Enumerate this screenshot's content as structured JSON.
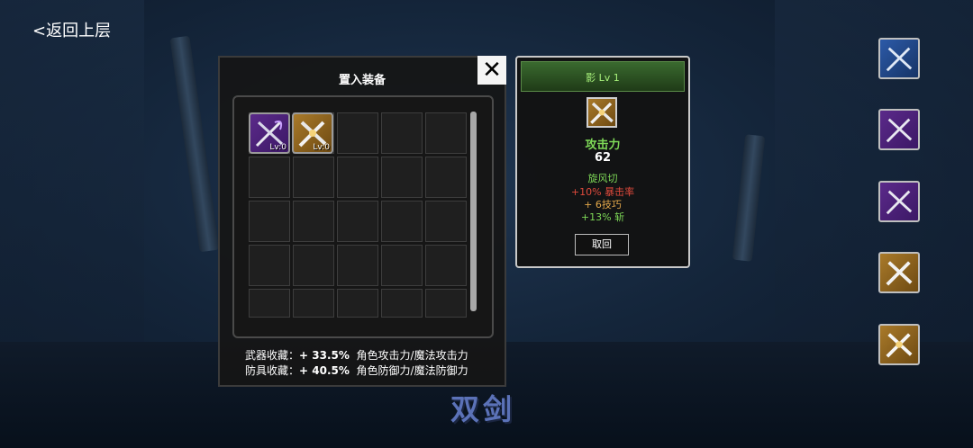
{
  "nav": {
    "back_label": "<返回上层"
  },
  "equip_panel": {
    "title": "置入装备",
    "close_label": "✕",
    "items": [
      {
        "icon": "purple-dual-swords-icon",
        "frame": "purple",
        "level": "Lv:0"
      },
      {
        "icon": "gold-dual-swords-icon",
        "frame": "gold",
        "level": "Lv:0"
      }
    ],
    "bonus_weapon": {
      "label": "武器收藏：",
      "value": "+ 33.5%",
      "desc": "角色攻击力/魔法攻击力"
    },
    "bonus_armor": {
      "label": "防具收藏：",
      "value": "+ 40.5%",
      "desc": "角色防御力/魔法防御力"
    }
  },
  "detail": {
    "name": "影 Lv 1",
    "icon": "gold-dual-swords-icon",
    "stat_label": "攻击力",
    "stat_value": "62",
    "skill": "旋风切",
    "bonus1": "+10% 暴击率",
    "bonus2": "+ 6技巧",
    "bonus3": "+13% 斩",
    "revert_label": "取回"
  },
  "side_buttons": [
    {
      "icon": "blue-dual-swords-icon",
      "frame": "blue"
    },
    {
      "icon": "purple-dual-swords-icon",
      "frame": "purple"
    },
    {
      "icon": "purple-dual-swords-icon",
      "frame": "purple"
    },
    {
      "icon": "gold-dual-swords-icon",
      "frame": "gold"
    },
    {
      "icon": "silver-gold-dual-swords-icon",
      "frame": "gold"
    }
  ],
  "category_title": "双剑",
  "colors": {
    "skill": "#7ed957",
    "bonus_red": "#e04a3c",
    "bonus_orange": "#e3a84a",
    "bonus_green": "#7ed957",
    "category": "#5b72b8"
  }
}
